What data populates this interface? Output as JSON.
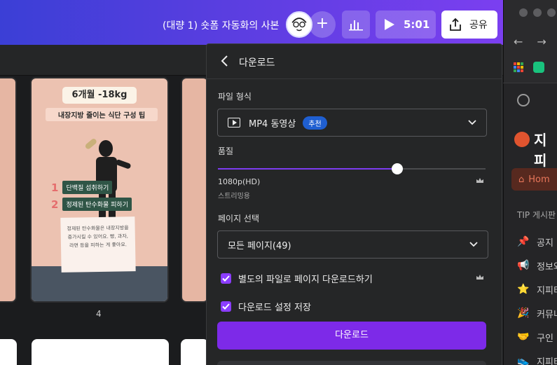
{
  "header": {
    "doc_title": "(대량 1) 숏폼 자동화의 사본",
    "add_label": "+",
    "play_time": "5:01",
    "share_label": "공유"
  },
  "colors": {
    "header_start": "#3b3fd6",
    "header_end": "#7b3ff0",
    "accent": "#7d2ae8",
    "checkbox": "#8b3dff",
    "recommend_badge": "#1f5fd1",
    "panel_bg": "#252627"
  },
  "design": {
    "months_badge": "6개월 -18kg",
    "subtitle": "내장지방 줄이는 식단 구성 팁",
    "steps": [
      {
        "num": "1",
        "text": "단백질 섭취하기"
      },
      {
        "num": "2",
        "text": "정제된 탄수화물 피하기"
      }
    ],
    "note_text": "정제된 탄수화물은 내장지방을 증가시킬 수 있어요. 빵, 과자, 라면 등을 피하는 게 좋아요.",
    "page_number": "4"
  },
  "download_panel": {
    "title": "다운로드",
    "file_format_label": "파일 형식",
    "file_format_value": "MP4 동영상",
    "recommend_badge": "추천",
    "quality_label": "품질",
    "quality_value": "1080p(HD)",
    "quality_sub": "스트리밍용",
    "quality_fraction": 0.67,
    "page_select_label": "페이지 선택",
    "page_select_value": "모든 페이지(49)",
    "separate_files_label": "별도의 파일로 페이지 다운로드하기",
    "separate_files_checked": true,
    "save_settings_label": "다운로드 설정 저장",
    "save_settings_checked": true,
    "download_button": "다운로드"
  },
  "browser": {
    "site_name": "지피",
    "home_label": "Hom",
    "tip_label": "TIP 게시판",
    "items": [
      {
        "icon": "pin-icon",
        "glyph": "📌",
        "label": "공지"
      },
      {
        "icon": "megaphone-icon",
        "glyph": "📢",
        "label": "정보와"
      },
      {
        "icon": "star-icon",
        "glyph": "⭐",
        "label": "지피티"
      },
      {
        "icon": "party-icon",
        "glyph": "🎉",
        "label": "커뮤니"
      },
      {
        "icon": "handshake-icon",
        "glyph": "🤝",
        "label": "구인"
      },
      {
        "icon": "shoe-icon",
        "glyph": "👟",
        "label": "지피티"
      }
    ]
  }
}
